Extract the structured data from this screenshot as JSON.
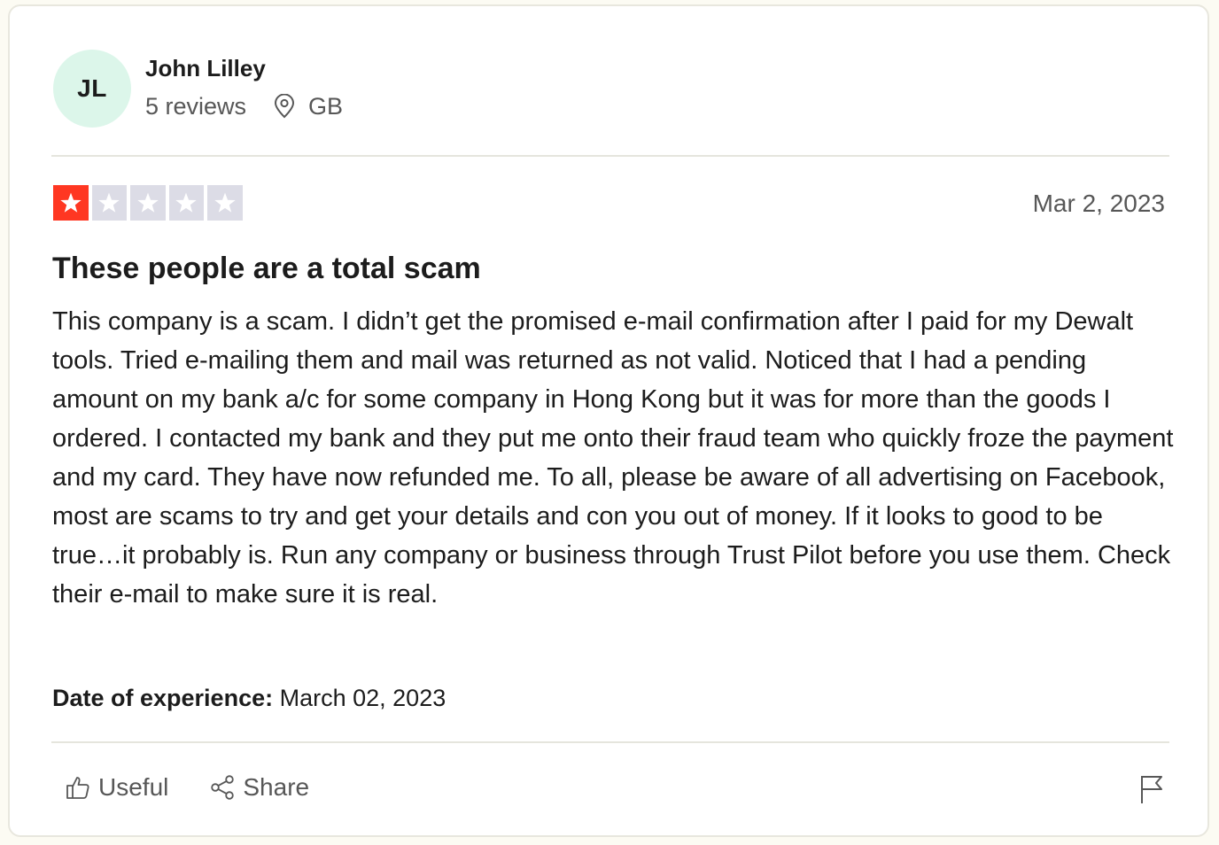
{
  "consumer": {
    "initials": "JL",
    "name": "John Lilley",
    "reviews_count": "5 reviews",
    "location": "GB",
    "avatar_color": "#dcf6ea"
  },
  "review": {
    "rating": 1,
    "max_rating": 5,
    "date": "Mar 2, 2023",
    "title": "These people are a total scam",
    "body": "This company is a scam. I didn’t get the promised e-mail confirmation after I paid for my Dewalt tools. Tried e-mailing them and mail was returned as not valid. Noticed that I had a pending amount on my bank a/c for some company in Hong Kong but it was for more than the goods I ordered. I contacted my bank and they put me onto their fraud team who quickly froze the payment and my card. They have now refunded me. To all, please be aware of all advertising on Facebook, most are scams to try and get your details and con you out of money. If it looks to good to be true…it probably is. Run any company or business through Trust Pilot before you use them. Check their e-mail to make sure it is real.",
    "experience_label": "Date of experience:",
    "experience_date": "March 02, 2023"
  },
  "actions": {
    "useful_label": "Useful",
    "share_label": "Share"
  },
  "icons": {
    "location": "location-pin-icon",
    "useful": "thumbs-up-icon",
    "share": "share-icon",
    "flag": "flag-icon",
    "star": "star-icon"
  },
  "colors": {
    "star_filled": "#ff3722",
    "star_empty": "#dcdce6",
    "text_primary": "#1c1c1c",
    "text_secondary": "#575757"
  }
}
